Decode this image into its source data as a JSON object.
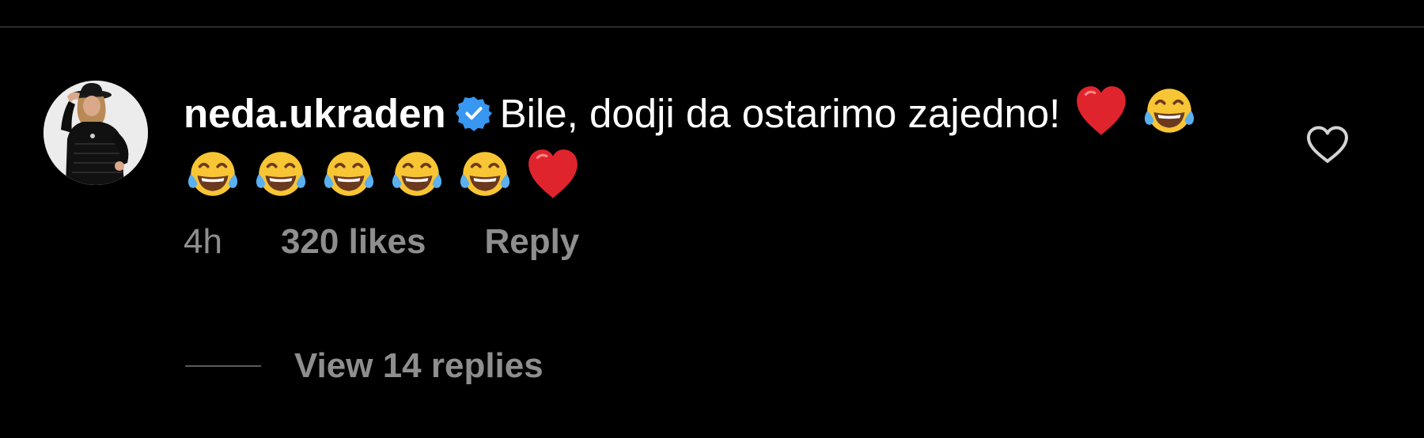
{
  "comment": {
    "username": "neda.ukraden",
    "verified": true,
    "text": "Bile, dodji da ostarimo zajedno!",
    "emojis": [
      "red-heart-icon",
      "tears-of-joy-icon",
      "tears-of-joy-icon",
      "tears-of-joy-icon",
      "tears-of-joy-icon",
      "tears-of-joy-icon",
      "tears-of-joy-icon",
      "red-heart-icon"
    ],
    "time": "4h",
    "likes": "320 likes",
    "reply_label": "Reply",
    "view_replies": "View 14 replies",
    "liked": false
  },
  "colors": {
    "background": "#000000",
    "text": "#ffffff",
    "muted": "#8e8e8e",
    "verified": "#3897f0",
    "heart": "#e0242d"
  }
}
